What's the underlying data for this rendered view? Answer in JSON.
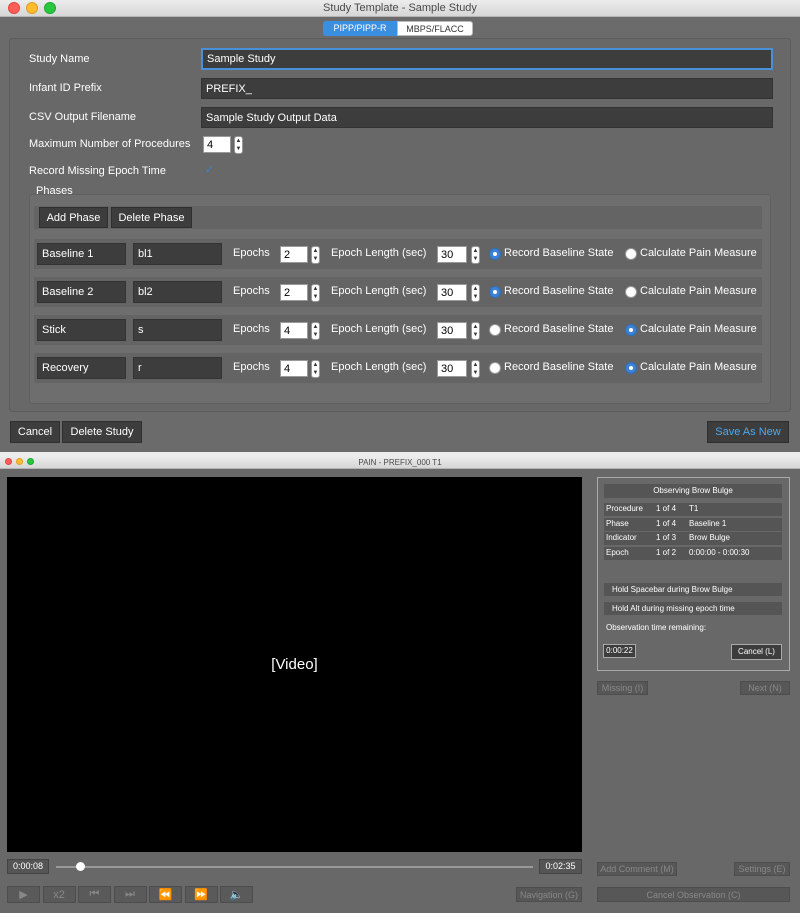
{
  "template_window": {
    "title": "Study Template - Sample Study",
    "tabs": [
      {
        "label": "PIPP/PIPP-R",
        "active": true
      },
      {
        "label": "MBPS/FLACC",
        "active": false
      }
    ],
    "fields": {
      "study_name": {
        "label": "Study Name",
        "value": "Sample Study"
      },
      "infant_id_prefix": {
        "label": "Infant ID Prefix",
        "value": "PREFIX_"
      },
      "csv_output": {
        "label": "CSV Output Filename",
        "value": "Sample Study Output Data"
      },
      "max_procedures": {
        "label": "Maximum Number of Procedures",
        "value": "4"
      },
      "record_missing": {
        "label": "Record Missing Epoch Time",
        "checked": true
      }
    },
    "phases": {
      "group_label": "Phases",
      "add_label": "Add Phase",
      "delete_label": "Delete Phase",
      "epochs_label": "Epochs",
      "epoch_length_label": "Epoch Length (sec)",
      "baseline_label": "Record Baseline State",
      "pain_label": "Calculate Pain Measure",
      "rows": [
        {
          "name": "Baseline 1",
          "code": "bl1",
          "epochs": "2",
          "length": "30",
          "mode": "baseline"
        },
        {
          "name": "Baseline 2",
          "code": "bl2",
          "epochs": "2",
          "length": "30",
          "mode": "baseline"
        },
        {
          "name": "Stick",
          "code": "s",
          "epochs": "4",
          "length": "30",
          "mode": "pain"
        },
        {
          "name": "Recovery",
          "code": "r",
          "epochs": "4",
          "length": "30",
          "mode": "pain"
        }
      ]
    },
    "footer": {
      "cancel": "Cancel",
      "delete_study": "Delete Study",
      "save_as_new": "Save As New"
    }
  },
  "pain_window": {
    "title": "PAIN - PREFIX_000 T1",
    "video_placeholder": "[Video]",
    "observing_header": "Observing Brow Bulge",
    "info": [
      {
        "key": "Procedure",
        "count": "1 of 4",
        "value": "T1"
      },
      {
        "key": "Phase",
        "count": "1 of 4",
        "value": "Baseline 1"
      },
      {
        "key": "Indicator",
        "count": "1 of 3",
        "value": "Brow Bulge"
      },
      {
        "key": "Epoch",
        "count": "1 of 2",
        "value": "0:00:00 - 0:00:30"
      }
    ],
    "hold_spacebar": "Hold Spacebar during Brow Bulge",
    "hold_alt": "Hold Alt during missing epoch time",
    "obs_time_label": "Observation time remaining:",
    "obs_time_value": "0:00:22",
    "cancel_l": "Cancel (L)",
    "missing": "Missing (I)",
    "next": "Next (N)",
    "add_comment": "Add Comment (M)",
    "settings": "Settings (E)",
    "cancel_observation": "Cancel Observation (C)",
    "navigation": "Navigation (G)",
    "time_current": "0:00:08",
    "time_total": "0:02:35",
    "playback_fraction": 0.052,
    "controls": [
      {
        "name": "play-icon",
        "glyph": "▶"
      },
      {
        "name": "speed-x2-icon",
        "glyph": "x2"
      },
      {
        "name": "step-back-icon",
        "glyph": "⏮"
      },
      {
        "name": "step-forward-icon",
        "glyph": "⏭"
      },
      {
        "name": "rewind-icon",
        "glyph": "⏪"
      },
      {
        "name": "fast-forward-icon",
        "glyph": "⏩"
      },
      {
        "name": "volume-icon",
        "glyph": "🔈"
      }
    ]
  }
}
